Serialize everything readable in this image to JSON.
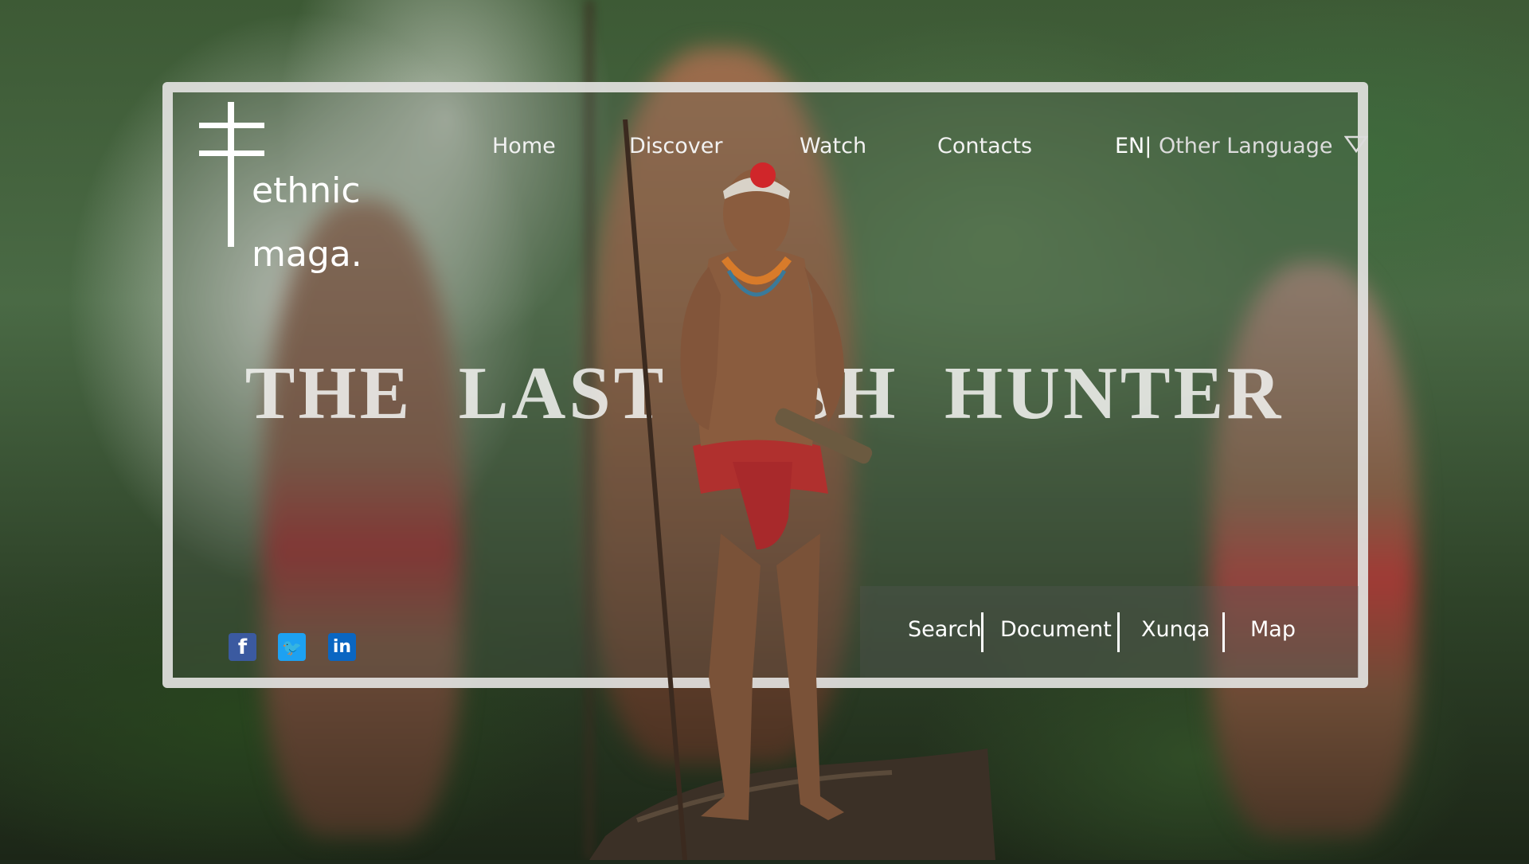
{
  "brand": {
    "line1": "ethnic",
    "line2": "maga."
  },
  "nav": {
    "items": [
      {
        "label": "Home"
      },
      {
        "label": "Discover"
      },
      {
        "label": "Watch"
      },
      {
        "label": "Contacts"
      }
    ]
  },
  "language": {
    "current": "EN|",
    "other": "Other Language"
  },
  "hero": {
    "headline": "THE LAST FISH HUNTER"
  },
  "footer_links": [
    {
      "label": "Search"
    },
    {
      "label": "Document"
    },
    {
      "label": "Xunqa"
    },
    {
      "label": "Map"
    }
  ],
  "social": [
    {
      "icon": "facebook-icon",
      "glyph": "f"
    },
    {
      "icon": "twitter-icon",
      "glyph": "🐦"
    },
    {
      "icon": "linkedin-icon",
      "glyph": "in"
    }
  ],
  "colors": {
    "frame": "#e4e4e2",
    "facebook": "#3b5aa0",
    "twitter": "#1da1f2",
    "linkedin": "#0a66c2"
  }
}
